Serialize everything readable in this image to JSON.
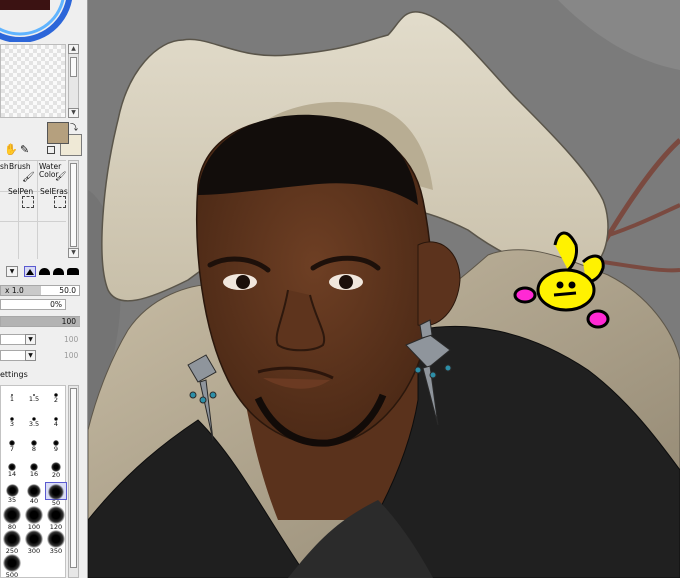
{
  "panel": {
    "tools": {
      "brush_prefix": "sh",
      "brush": "Brush",
      "water_color_line1": "Water",
      "water_color_line2": "Color",
      "selpen": "SelPen",
      "seleras": "SelEras"
    },
    "brush_size": {
      "multiplier": "x 1.0",
      "value": "50.0"
    },
    "min_size": {
      "value": "0%"
    },
    "density": {
      "value": "100"
    },
    "dropdown1": {
      "value": "100"
    },
    "dropdown2": {
      "value": "100"
    },
    "settings_label": "ettings",
    "size_presets": {
      "rows": [
        [
          "1",
          "1.5",
          "2"
        ],
        [
          "3",
          "3.5",
          "4"
        ],
        [
          "7",
          "8",
          "9"
        ],
        [
          "14",
          "16",
          "20"
        ],
        [
          "35",
          "40",
          "50"
        ],
        [
          "80",
          "100",
          "120"
        ],
        [
          "250",
          "300",
          "350"
        ],
        [
          "500",
          "",
          ""
        ]
      ],
      "selected": "50"
    }
  },
  "colors": {
    "primary": "#b5a07e",
    "secondary": "#efe9d6",
    "selection": "#5a5ad0",
    "bunny": "#fff200",
    "bunny_feet": "#ff29d4"
  }
}
